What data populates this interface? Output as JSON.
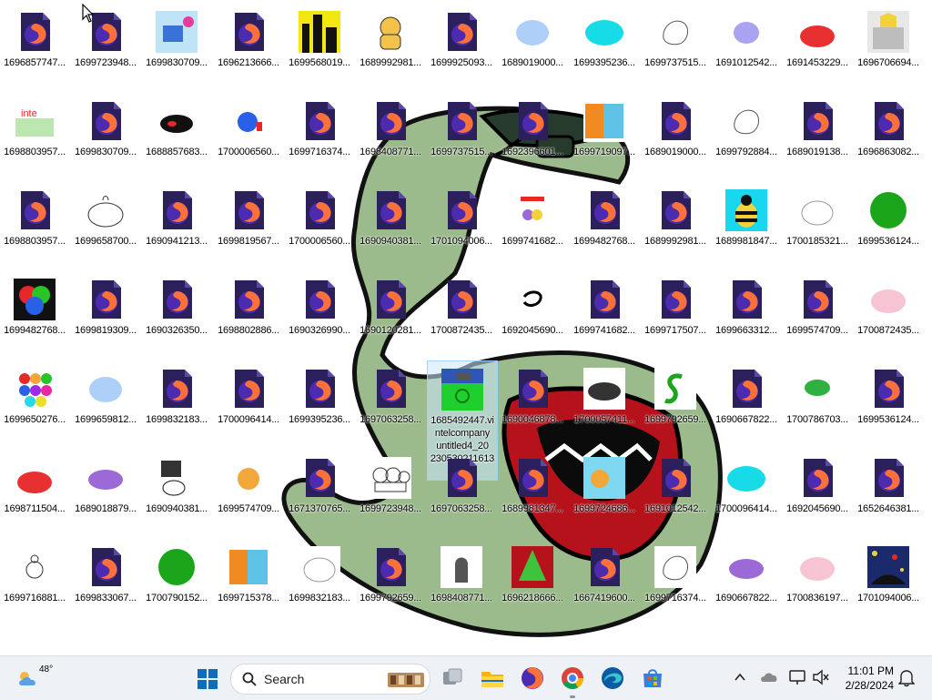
{
  "desktop": {
    "icons": [
      {
        "label": "1696857747...",
        "thumb": "firefox-file-icon"
      },
      {
        "label": "1699723948...",
        "thumb": "firefox-file-icon"
      },
      {
        "label": "1699830709...",
        "thumb": "drawing-blue-cup"
      },
      {
        "label": "1696213666...",
        "thumb": "firefox-file-icon"
      },
      {
        "label": "1699568019...",
        "thumb": "yellow-city-image"
      },
      {
        "label": "1689992981...",
        "thumb": "cat-drawing"
      },
      {
        "label": "1699925093...",
        "thumb": "firefox-file-icon"
      },
      {
        "label": "1689019000...",
        "thumb": "blue-blob-image"
      },
      {
        "label": "1699395236...",
        "thumb": "cyan-blob-image"
      },
      {
        "label": "1699737515...",
        "thumb": "sketch-drawing"
      },
      {
        "label": "1691012542...",
        "thumb": "lavender-blob-image"
      },
      {
        "label": "1691453229...",
        "thumb": "red-blob-image"
      },
      {
        "label": "1696706694...",
        "thumb": "castle-image"
      },
      {
        "label": "1698803957...",
        "thumb": "green-text-image"
      },
      {
        "label": "1699830709...",
        "thumb": "firefox-file-icon"
      },
      {
        "label": "1688857683...",
        "thumb": "black-red-car-image"
      },
      {
        "label": "1700006560...",
        "thumb": "blue-ball-image"
      },
      {
        "label": "1699716374...",
        "thumb": "firefox-file-icon"
      },
      {
        "label": "1698408771...",
        "thumb": "firefox-file-icon"
      },
      {
        "label": "1699737515...",
        "thumb": "firefox-file-icon"
      },
      {
        "label": "1692396601...",
        "thumb": "firefox-file-icon"
      },
      {
        "label": "1699719097...",
        "thumb": "orange-blue-image"
      },
      {
        "label": "1689019000...",
        "thumb": "firefox-file-icon"
      },
      {
        "label": "1699792884...",
        "thumb": "sketch-drawing"
      },
      {
        "label": "1689019138...",
        "thumb": "firefox-file-icon"
      },
      {
        "label": "1696863082...",
        "thumb": "firefox-file-icon"
      },
      {
        "label": "1698803957...",
        "thumb": "firefox-file-icon"
      },
      {
        "label": "1699658700...",
        "thumb": "pot-sketch"
      },
      {
        "label": "1690941213...",
        "thumb": "firefox-file-icon"
      },
      {
        "label": "1699819567...",
        "thumb": "firefox-file-icon"
      },
      {
        "label": "1700006560...",
        "thumb": "firefox-file-icon"
      },
      {
        "label": "1690940381...",
        "thumb": "firefox-file-icon"
      },
      {
        "label": "1701094006...",
        "thumb": "firefox-file-icon"
      },
      {
        "label": "1699741682...",
        "thumb": "colorful-sketch"
      },
      {
        "label": "1699482768...",
        "thumb": "firefox-file-icon"
      },
      {
        "label": "1689992981...",
        "thumb": "firefox-file-icon"
      },
      {
        "label": "1689981847...",
        "thumb": "bee-image"
      },
      {
        "label": "1700185321...",
        "thumb": "white-blob-sketch"
      },
      {
        "label": "1699536124...",
        "thumb": "green-circle-image"
      },
      {
        "label": "1699482768...",
        "thumb": "rgb-circles-image"
      },
      {
        "label": "1699819309...",
        "thumb": "firefox-file-icon"
      },
      {
        "label": "1690326350...",
        "thumb": "firefox-file-icon"
      },
      {
        "label": "1698802886...",
        "thumb": "firefox-file-icon"
      },
      {
        "label": "1690326990...",
        "thumb": "firefox-file-icon"
      },
      {
        "label": "1690120281...",
        "thumb": "firefox-file-icon"
      },
      {
        "label": "1700872435...",
        "thumb": "firefox-file-icon"
      },
      {
        "label": "1692045690...",
        "thumb": "face-sketch"
      },
      {
        "label": "1699741682...",
        "thumb": "firefox-file-icon"
      },
      {
        "label": "1699717507...",
        "thumb": "firefox-file-icon"
      },
      {
        "label": "1699663312...",
        "thumb": "firefox-file-icon"
      },
      {
        "label": "1699574709...",
        "thumb": "firefox-file-icon"
      },
      {
        "label": "1700872435...",
        "thumb": "pink-blob-image"
      },
      {
        "label": "1699650276...",
        "thumb": "colorful-dots-image"
      },
      {
        "label": "1699659812...",
        "thumb": "blue-blob-image"
      },
      {
        "label": "1699832183...",
        "thumb": "firefox-file-icon"
      },
      {
        "label": "1700096414...",
        "thumb": "firefox-file-icon"
      },
      {
        "label": "1699395236...",
        "thumb": "firefox-file-icon"
      },
      {
        "label": "1697063258...",
        "thumb": "firefox-file-icon"
      },
      {
        "label": "1685492447.vi\nntelcompany\nuntitled4_20\n230530211613\n.png",
        "thumb": "green-game-screenshot",
        "selected": true
      },
      {
        "label": "1690046878...",
        "thumb": "firefox-file-icon"
      },
      {
        "label": "1700057411...",
        "thumb": "dark-blob-image"
      },
      {
        "label": "1699792659...",
        "thumb": "green-s-image"
      },
      {
        "label": "1690667822...",
        "thumb": "firefox-file-icon"
      },
      {
        "label": "1700786703...",
        "thumb": "green-blob-image"
      },
      {
        "label": "1699536124...",
        "thumb": "firefox-file-icon"
      },
      {
        "label": "1698711504...",
        "thumb": "red-blob-image"
      },
      {
        "label": "1689018879...",
        "thumb": "purple-blob-image"
      },
      {
        "label": "1690940381...",
        "thumb": "dark-scene-image"
      },
      {
        "label": "1699574709...",
        "thumb": "orange-ball-image"
      },
      {
        "label": "1671370765...",
        "thumb": "firefox-file-icon"
      },
      {
        "label": "1699723948...",
        "thumb": "bubbles-sketch"
      },
      {
        "label": "1697063258...",
        "thumb": "firefox-file-icon"
      },
      {
        "label": "1689981347...",
        "thumb": "firefox-file-icon"
      },
      {
        "label": "1699724686...",
        "thumb": "orange-cyan-image"
      },
      {
        "label": "1691012542...",
        "thumb": "firefox-file-icon"
      },
      {
        "label": "1700096414...",
        "thumb": "cyan-blob-image"
      },
      {
        "label": "1692045690...",
        "thumb": "firefox-file-icon"
      },
      {
        "label": "1652646381...",
        "thumb": "firefox-file-icon"
      },
      {
        "label": "1699716881...",
        "thumb": "small-sketch"
      },
      {
        "label": "1699833067...",
        "thumb": "firefox-file-icon"
      },
      {
        "label": "1700790152...",
        "thumb": "green-circle-image"
      },
      {
        "label": "1699715378...",
        "thumb": "orange-blue-image"
      },
      {
        "label": "1699832183...",
        "thumb": "white-blob-sketch"
      },
      {
        "label": "1699792659...",
        "thumb": "firefox-file-icon"
      },
      {
        "label": "1698408771...",
        "thumb": "gray-shape-image"
      },
      {
        "label": "1696218666...",
        "thumb": "green-cone-image"
      },
      {
        "label": "1667419600...",
        "thumb": "firefox-file-icon"
      },
      {
        "label": "1699716374...",
        "thumb": "sketch-drawing"
      },
      {
        "label": "1690667822...",
        "thumb": "purple-blob-image"
      },
      {
        "label": "1700836197...",
        "thumb": "pink-blob-image"
      },
      {
        "label": "1701094006...",
        "thumb": "space-image"
      }
    ]
  },
  "taskbar": {
    "weather": {
      "temp": "48°",
      "icon": "weather-cloud-sun-icon"
    },
    "start_icon": "windows-start-icon",
    "search": {
      "label": "Search",
      "icon": "search-icon"
    },
    "apps": [
      "task-view-icon",
      "file-explorer-icon",
      "firefox-icon",
      "chrome-icon",
      "edge-icon",
      "microsoft-store-icon"
    ],
    "tray": [
      "chevron-up-icon",
      "onedrive-cloud-icon",
      "network-icon",
      "speaker-muted-icon"
    ],
    "clock": {
      "time": "11:01 PM",
      "date": "2/28/2024"
    },
    "notification_icon": "notification-bell-icon"
  },
  "colors": {
    "taskbar_bg": "#eef2f6",
    "wallpaper_green": "#9cbb8d",
    "wallpaper_red": "#b5121b",
    "firefox_orange": "#ff7139",
    "firefox_purple": "#4d2bb0"
  }
}
